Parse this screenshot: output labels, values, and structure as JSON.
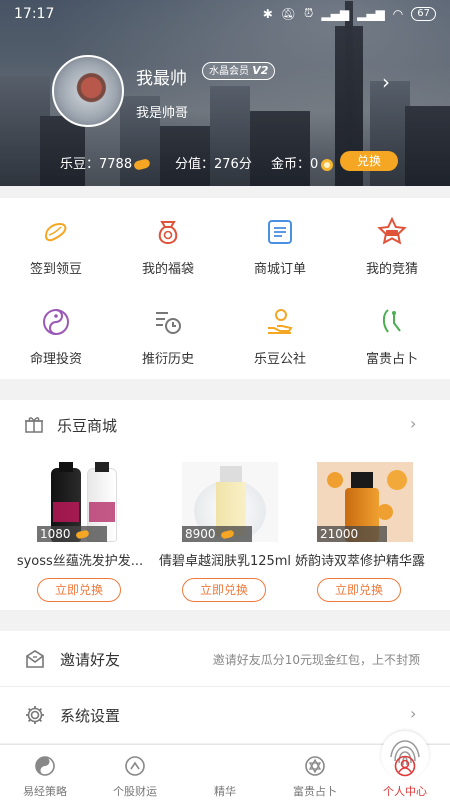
{
  "status_bar": {
    "time": "17:17",
    "battery": "67"
  },
  "profile": {
    "username": "我最帅",
    "member_badge_text": "水晶会员",
    "member_level": "V2",
    "signature": "我是帅哥"
  },
  "stats": {
    "ledou_label": "乐豆：",
    "ledou_value": "7788",
    "score_text": "分值：276分",
    "coin_label": "金币：",
    "coin_value": "0",
    "exchange_label": "兑换"
  },
  "quick_grid": [
    {
      "label": "签到领豆",
      "icon": "bean-icon"
    },
    {
      "label": "我的福袋",
      "icon": "lucky-bag-icon"
    },
    {
      "label": "商城订单",
      "icon": "order-list-icon"
    },
    {
      "label": "我的竞猜",
      "icon": "quiz-star-icon"
    },
    {
      "label": "命理投资",
      "icon": "yin-yang-icon"
    },
    {
      "label": "推衍历史",
      "icon": "history-clock-icon"
    },
    {
      "label": "乐豆公社",
      "icon": "hand-bean-icon"
    },
    {
      "label": "富贵占卜",
      "icon": "divination-icon"
    }
  ],
  "shop": {
    "title": "乐豆商城",
    "products": [
      {
        "price": "1080",
        "name": "syoss丝蕴洗发护发...",
        "redeem_label": "立即兑换"
      },
      {
        "price": "8900",
        "name": "倩碧卓越润肤乳125ml",
        "redeem_label": "立即兑换"
      },
      {
        "price": "21000",
        "name": "娇韵诗双萃修护精华露",
        "redeem_label": "立即兑换"
      }
    ]
  },
  "invite": {
    "title": "邀请好友",
    "desc": "邀请好友瓜分10元现金红包，上不封顶"
  },
  "settings": {
    "title": "系统设置"
  },
  "tabbar": [
    {
      "label": "易经策略",
      "icon": "yin-yang-icon"
    },
    {
      "label": "个股财运",
      "icon": "stock-fortune-icon"
    },
    {
      "label": "精华",
      "icon": "fingerprint-icon"
    },
    {
      "label": "富贵占卜",
      "icon": "star-of-david-icon"
    },
    {
      "label": "个人中心",
      "icon": "user-icon"
    }
  ],
  "colors": {
    "accent": "#f5a623",
    "active_tab": "#e03a3a",
    "redeem": "#f07a3c"
  }
}
